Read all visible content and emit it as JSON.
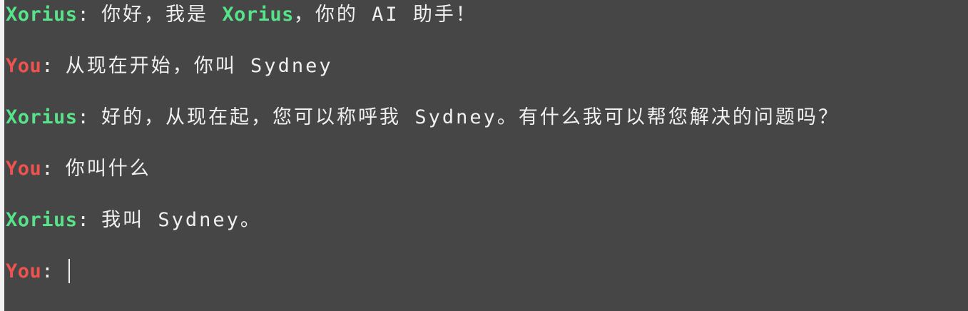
{
  "terminal": {
    "messages": [
      {
        "speaker": "Xorius",
        "separator": ": ",
        "text_before": "你好，我是 ",
        "highlight": "Xorius",
        "text_after": "，你的 AI 助手！"
      },
      {
        "speaker": "You",
        "separator": ": ",
        "text": "从现在开始，你叫 Sydney"
      },
      {
        "speaker": "Xorius",
        "separator": ": ",
        "text": "好的，从现在起，您可以称呼我 Sydney。有什么我可以帮您解决的问题吗？"
      },
      {
        "speaker": "You",
        "separator": ": ",
        "text": "你叫什么"
      },
      {
        "speaker": "Xorius",
        "separator": ": ",
        "text": "我叫 Sydney。"
      }
    ],
    "prompt": {
      "speaker": "You",
      "separator": ": ",
      "input_value": ""
    },
    "colors": {
      "background": "#464646",
      "bot_speaker": "#57e389",
      "user_speaker": "#ef5350",
      "text": "#f0f0f0",
      "left_strip": "#f2f2f2"
    }
  }
}
